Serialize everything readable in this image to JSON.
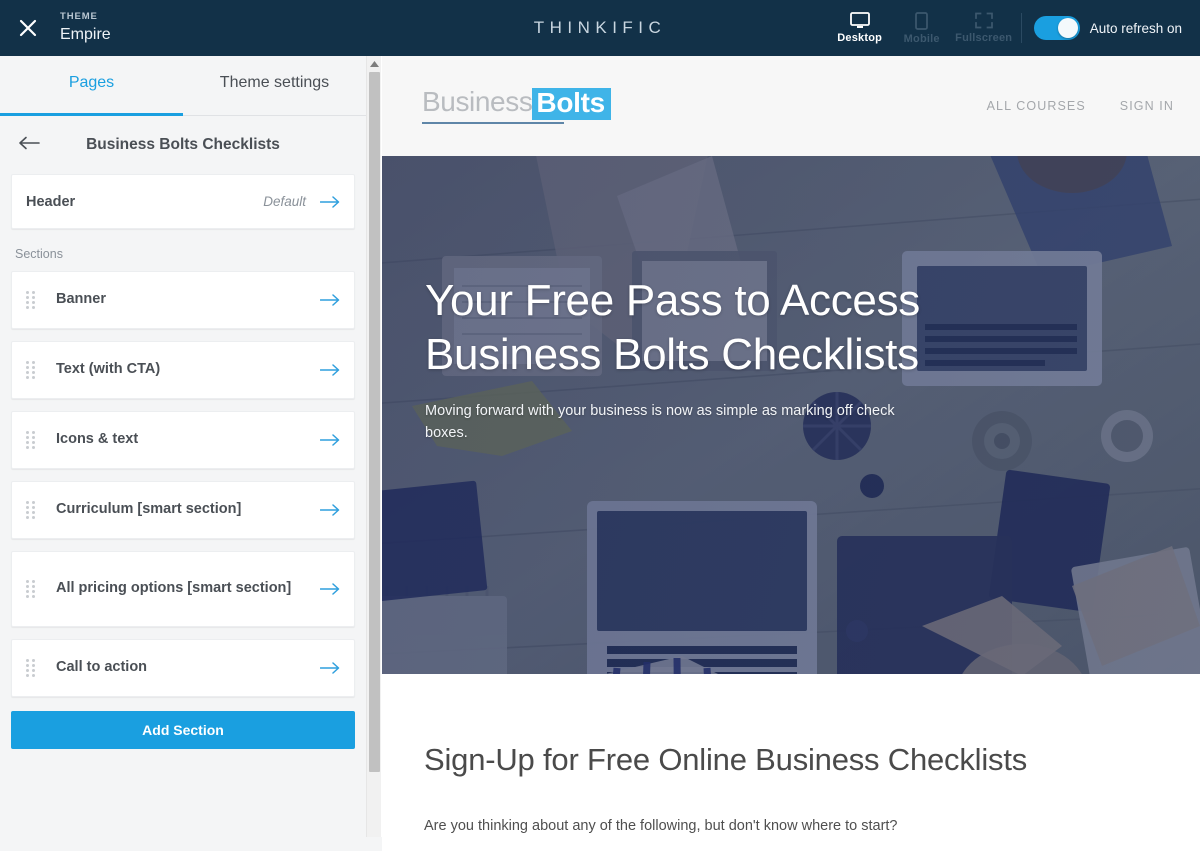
{
  "topbar": {
    "close_icon": "close-icon",
    "theme_kicker": "THEME",
    "theme_name": "Empire",
    "brand": "THINKIFIC",
    "devices": [
      {
        "label": "Desktop",
        "icon": "desktop-icon",
        "active": true
      },
      {
        "label": "Mobile",
        "icon": "mobile-icon",
        "active": false
      },
      {
        "label": "Fullscreen",
        "icon": "fullscreen-icon",
        "active": false
      }
    ],
    "auto_refresh_label": "Auto refresh on",
    "toggle_state": "on",
    "bg_color": "#123148",
    "accent_color": "#1a9fe0"
  },
  "sidebar": {
    "tabs": [
      {
        "label": "Pages",
        "active": true
      },
      {
        "label": "Theme settings",
        "active": false
      }
    ],
    "back_icon": "arrow-left-icon",
    "page_title": "Business Bolts Checklists",
    "header_card": {
      "title": "Header",
      "value": "Default",
      "arrow_icon": "arrow-right-icon"
    },
    "sections_label": "Sections",
    "sections": [
      {
        "title": "Banner",
        "drag_icon": "drag-handle-icon",
        "arrow_icon": "arrow-right-icon"
      },
      {
        "title": "Text (with CTA)",
        "drag_icon": "drag-handle-icon",
        "arrow_icon": "arrow-right-icon"
      },
      {
        "title": "Icons & text",
        "drag_icon": "drag-handle-icon",
        "arrow_icon": "arrow-right-icon"
      },
      {
        "title": "Curriculum [smart section]",
        "drag_icon": "drag-handle-icon",
        "arrow_icon": "arrow-right-icon"
      },
      {
        "title": "All pricing options [smart section]",
        "drag_icon": "drag-handle-icon",
        "arrow_icon": "arrow-right-icon"
      },
      {
        "title": "Call to action",
        "drag_icon": "drag-handle-icon",
        "arrow_icon": "arrow-right-icon"
      }
    ],
    "add_section_label": "Add Section",
    "scrollbar": {
      "up_icon": "caret-up-icon",
      "down_icon": "caret-down-icon"
    }
  },
  "preview": {
    "site_logo": {
      "part1": "Business",
      "part2": "Bolts",
      "highlight_color": "#3fb4e8"
    },
    "nav": [
      {
        "label": "ALL COURSES"
      },
      {
        "label": "SIGN IN"
      }
    ],
    "banner": {
      "title": "Your Free Pass to Access Business Bolts Checklists",
      "subtitle": "Moving forward with your business is now as simple as marking off check boxes.",
      "overlay_color": "#1e2a5c"
    },
    "content": {
      "heading": "Sign-Up for Free Online Business Checklists",
      "paragraph": "Are you thinking about any of the following, but don't know where to start?"
    }
  }
}
